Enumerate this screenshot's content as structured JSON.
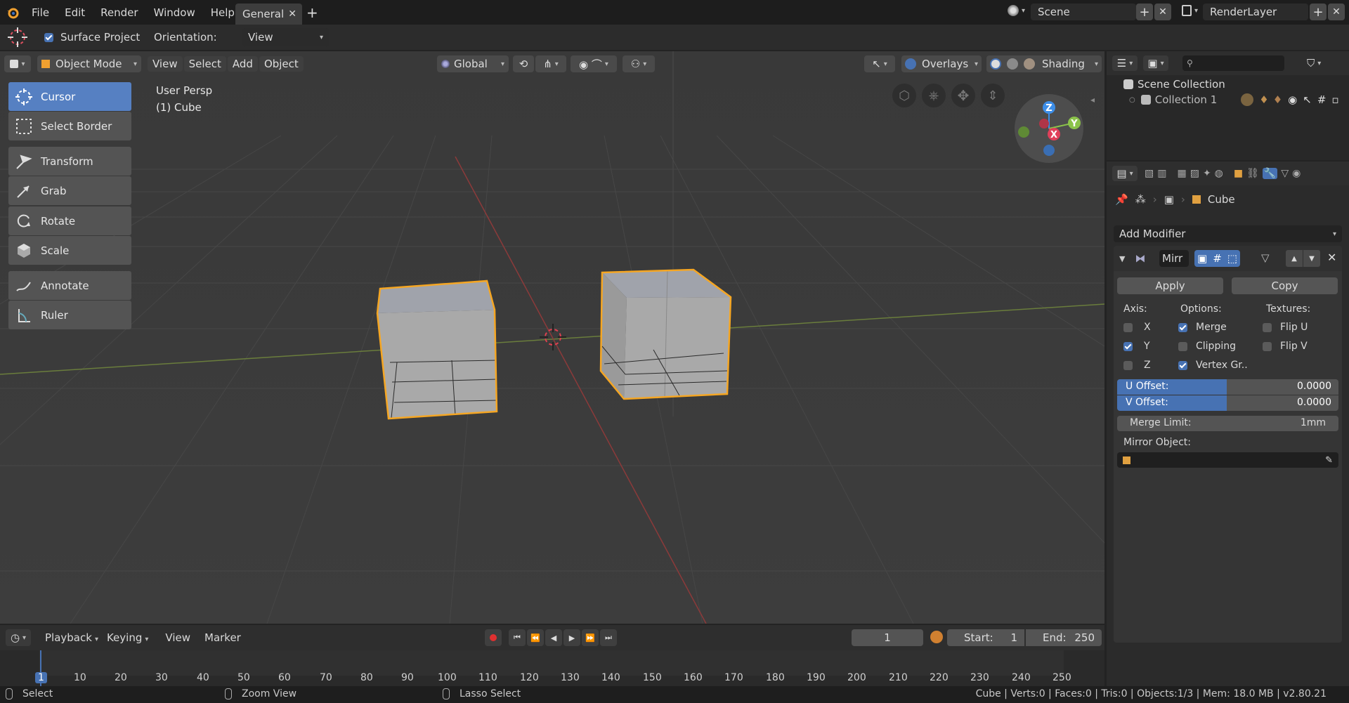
{
  "topbar": {
    "menus": [
      "File",
      "Edit",
      "Render",
      "Window",
      "Help"
    ],
    "workspace_tab": "General",
    "scene_label": "Scene",
    "renderlayer_label": "RenderLayer"
  },
  "tool_settings": {
    "surface_project_label": "Surface Project",
    "surface_project_checked": true,
    "orientation_label": "Orientation:",
    "orientation_value": "View"
  },
  "viewport_header": {
    "mode": "Object Mode",
    "menus": [
      "View",
      "Select",
      "Add",
      "Object"
    ],
    "transform_orientation": "Global",
    "overlays_label": "Overlays",
    "shading_label": "Shading"
  },
  "viewport": {
    "view_name": "User Persp",
    "active_object": "(1) Cube",
    "gizmo_axes": [
      "Z",
      "Y",
      "X"
    ]
  },
  "toolbar": {
    "tools": [
      {
        "label": "Cursor",
        "icon": "cursor-icon",
        "active": true
      },
      {
        "label": "Select Border",
        "icon": "select-border-icon",
        "active": false
      },
      {
        "label": "Transform",
        "icon": "transform-icon",
        "active": false
      },
      {
        "label": "Grab",
        "icon": "grab-icon",
        "active": false
      },
      {
        "label": "Rotate",
        "icon": "rotate-icon",
        "active": false
      },
      {
        "label": "Scale",
        "icon": "scale-icon",
        "active": false
      },
      {
        "label": "Annotate",
        "icon": "annotate-icon",
        "active": false
      },
      {
        "label": "Ruler",
        "icon": "ruler-icon",
        "active": false
      }
    ]
  },
  "outliner": {
    "scene_collection": "Scene Collection",
    "collection": "Collection 1"
  },
  "properties": {
    "breadcrumb_object": "Cube",
    "add_modifier_label": "Add Modifier",
    "modifier_name": "Mirr",
    "apply_label": "Apply",
    "copy_label": "Copy",
    "axis_header": "Axis:",
    "options_header": "Options:",
    "textures_header": "Textures:",
    "axis": [
      {
        "label": "X",
        "checked": false
      },
      {
        "label": "Y",
        "checked": true
      },
      {
        "label": "Z",
        "checked": false
      }
    ],
    "options": [
      {
        "label": "Merge",
        "checked": true
      },
      {
        "label": "Clipping",
        "checked": false
      },
      {
        "label": "Vertex Gr..",
        "checked": true
      }
    ],
    "textures": [
      {
        "label": "Flip U",
        "checked": false
      },
      {
        "label": "Flip V",
        "checked": false
      }
    ],
    "u_offset_label": "U Offset:",
    "u_offset_value": "0.0000",
    "v_offset_label": "V Offset:",
    "v_offset_value": "0.0000",
    "merge_limit_label": "Merge Limit:",
    "merge_limit_value": "1mm",
    "mirror_object_label": "Mirror Object:"
  },
  "timeline": {
    "menus": [
      "Playback",
      "Keying",
      "View",
      "Marker"
    ],
    "current_frame": "1",
    "start_label": "Start:",
    "start_value": "1",
    "end_label": "End:",
    "end_value": "250",
    "ticks": [
      "1",
      "10",
      "20",
      "30",
      "40",
      "50",
      "60",
      "70",
      "80",
      "90",
      "100",
      "110",
      "120",
      "130",
      "140",
      "150",
      "160",
      "170",
      "180",
      "190",
      "200",
      "210",
      "220",
      "230",
      "240",
      "250"
    ]
  },
  "statusbar": {
    "select": "Select",
    "zoom_view": "Zoom View",
    "lasso_select": "Lasso Select",
    "stats": "Cube | Verts:0 | Faces:0 | Tris:0 | Objects:1/3 | Mem: 18.0 MB | v2.80.21"
  },
  "colors": {
    "accent": "#4772b3",
    "selection_outline": "#f5a623",
    "x_axis": "#e0405a",
    "y_axis": "#8bc34a",
    "z_axis": "#3d8ee8"
  }
}
